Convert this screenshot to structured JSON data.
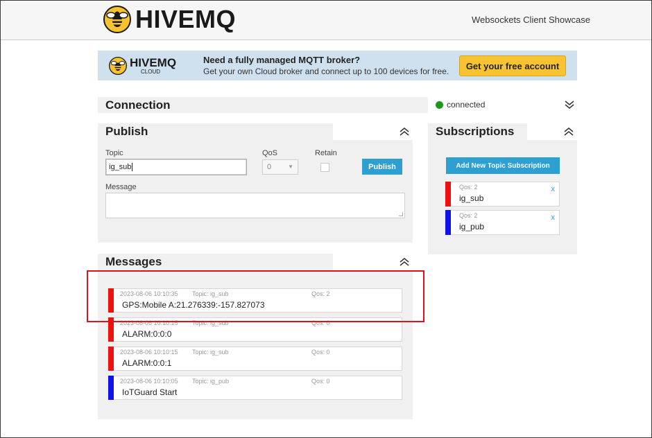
{
  "header": {
    "brand": "HIVEMQ",
    "subtitle": "Websockets Client Showcase"
  },
  "banner": {
    "brand": "HIVEMQ",
    "brand_sub": "CLOUD",
    "title": "Need a fully managed MQTT broker?",
    "text": "Get your own Cloud broker and connect up to 100 devices for free.",
    "button": "Get your free account"
  },
  "connection": {
    "title": "Connection",
    "status": "connected",
    "status_color": "#1a9a1a"
  },
  "publish": {
    "title": "Publish",
    "topic_label": "Topic",
    "topic_value": "ig_sub",
    "qos_label": "QoS",
    "qos_value": "0",
    "retain_label": "Retain",
    "button": "Publish",
    "message_label": "Message"
  },
  "subscriptions": {
    "title": "Subscriptions",
    "add_button": "Add New Topic Subscription",
    "items": [
      {
        "qos": "Qos: 2",
        "topic": "ig_sub",
        "color": "#ee1111",
        "close": "x"
      },
      {
        "qos": "Qos: 2",
        "topic": "ig_pub",
        "color": "#1111ee",
        "close": "x"
      }
    ]
  },
  "messages": {
    "title": "Messages",
    "items": [
      {
        "date": "2023-08-06 10:10:35",
        "topic": "Topic: ig_sub",
        "qos": "Qos: 2",
        "text": "GPS:Mobile A:21.276339:-157.827073",
        "color": "#ee1111"
      },
      {
        "date": "2023-08-06 10:10:15",
        "topic": "Topic: ig_sub",
        "qos": "Qos: 0",
        "text": "ALARM:0:0:0",
        "color": "#ee1111"
      },
      {
        "date": "2023-08-06 10:10:15",
        "topic": "Topic: ig_sub",
        "qos": "Qos: 0",
        "text": "ALARM:0:0:1",
        "color": "#ee1111"
      },
      {
        "date": "2023-08-06 10:10:05",
        "topic": "Topic: ig_pub",
        "qos": "Qos: 0",
        "text": "IoTGuard Start",
        "color": "#1111ee"
      }
    ]
  },
  "colors": {
    "accent": "#2d9fd0",
    "highlight": "#e0111a",
    "banner_button": "#f8c331"
  }
}
